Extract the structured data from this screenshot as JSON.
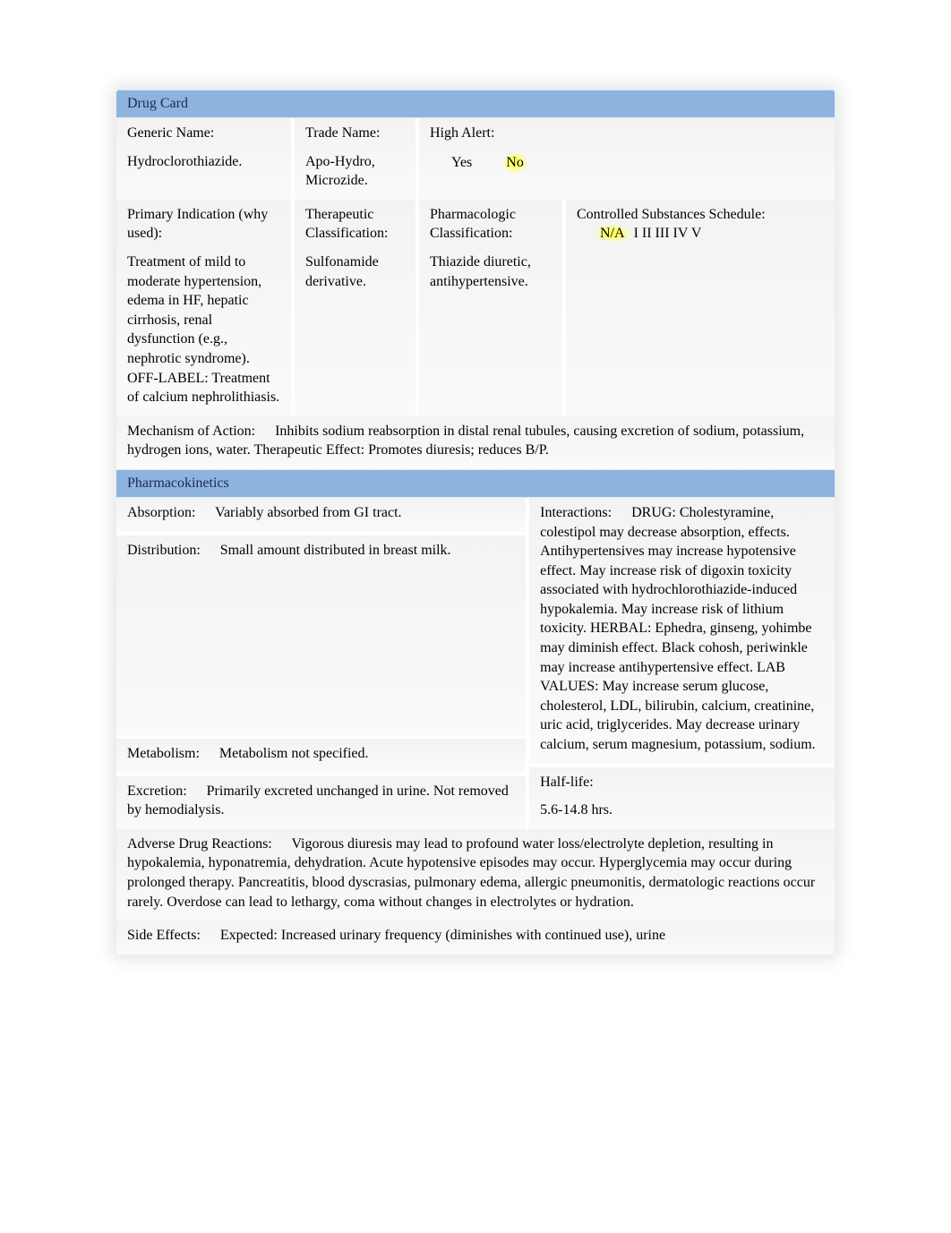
{
  "headers": {
    "drug_card": "Drug Card",
    "pharmacokinetics": "Pharmacokinetics"
  },
  "top": {
    "generic_name_label": "Generic Name:",
    "generic_name_value": "Hydroclorothiazide.",
    "trade_name_label": "Trade Name:",
    "trade_name_value": "Apo-Hydro, Microzide.",
    "high_alert_label": "High Alert:",
    "yes": "Yes",
    "no": "No"
  },
  "classification": {
    "primary_label": "Primary Indication (why used):",
    "primary_value": "Treatment of mild to moderate hypertension, edema in HF, hepatic cirrhosis, renal dysfunction (e.g., nephrotic syndrome). OFF-LABEL: Treatment of calcium nephrolithiasis.",
    "therapeutic_label": "Therapeutic Classification:",
    "therapeutic_value": "Sulfonamide derivative.",
    "pharmacologic_label": "Pharmacologic Classification:",
    "pharmacologic_value": "Thiazide diuretic, antihypertensive.",
    "controlled_label": "Controlled Substances Schedule:",
    "controlled_na": "N/A",
    "controlled_rest": " I II III IV V"
  },
  "moa": {
    "label": "Mechanism of Action:",
    "value": "Inhibits sodium reabsorption in distal renal tubules, causing excretion of sodium, potassium, hydrogen ions, water. Therapeutic Effect: Promotes diuresis; reduces B/P."
  },
  "pk": {
    "absorption_label": "Absorption:",
    "absorption_value": "Variably absorbed from GI tract.",
    "distribution_label": "Distribution:",
    "distribution_value": "Small amount distributed in breast milk.",
    "metabolism_label": "Metabolism:",
    "metabolism_value": "Metabolism not specified.",
    "excretion_label": "Excretion:",
    "excretion_value": "Primarily excreted unchanged in urine. Not removed by hemodialysis.",
    "interactions_label": "Interactions:",
    "interactions_value": "DRUG: Cholestyramine, colestipol may decrease absorption, effects. Antihypertensives may increase hypotensive effect. May increase risk of digoxin toxicity associated with hydrochlorothiazide-induced hypokalemia. May increase risk of lithium toxicity. HERBAL: Ephedra, ginseng, yohimbe may diminish effect. Black cohosh, periwinkle may increase antihypertensive effect. LAB VALUES: May increase serum glucose, cholesterol, LDL, bilirubin, calcium, creatinine, uric acid, triglycerides. May decrease urinary calcium, serum magnesium, potassium, sodium.",
    "half_life_label": "Half-life:",
    "half_life_value": "5.6-14.8 hrs."
  },
  "adr": {
    "label": "Adverse Drug Reactions:",
    "value": "Vigorous diuresis may lead to profound water loss/electrolyte depletion, resulting in hypokalemia, hyponatremia, dehydration. Acute hypotensive episodes may occur. Hyperglycemia may occur during prolonged therapy. Pancreatitis, blood dyscrasias, pulmonary edema, allergic pneumonitis, dermatologic reactions occur rarely. Overdose can lead to lethargy, coma without changes in electrolytes or hydration."
  },
  "side_effects": {
    "label": "Side Effects:",
    "value": "Expected: Increased urinary frequency (diminishes with continued use), urine"
  }
}
